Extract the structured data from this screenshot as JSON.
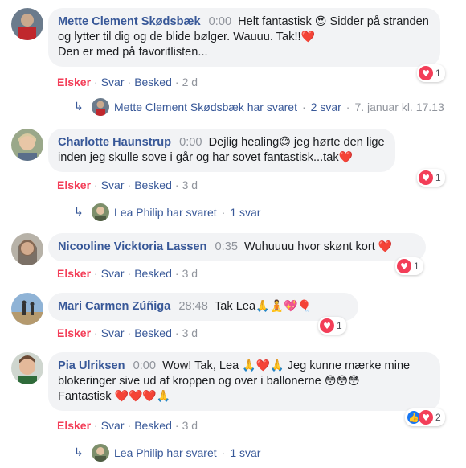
{
  "comments": [
    {
      "name": "Mette Clement Skødsbæk",
      "timestamp": "0:00",
      "text_a": "Helt fantastisk ",
      "emoji_a": "😍",
      "text_b": " Sidder på stranden og lytter til dig og de blide bølger. Wauuu. Tak!!",
      "emoji_b": "❤️",
      "text_c": "Den er med på favoritlisten...",
      "reaction_count": "1",
      "reaction_icon": "heart-icon",
      "actions": {
        "react": "Elsker",
        "reply": "Svar",
        "message": "Besked",
        "age": "2 d"
      },
      "reply_summary": {
        "author": "Mette Clement Skødsbæk har svaret",
        "count": "2 svar",
        "date": "7. januar kl. 17.13"
      }
    },
    {
      "name": "Charlotte Haunstrup",
      "timestamp": "0:00",
      "text_a": "Dejlig healing",
      "emoji_a": "😊",
      "text_b": " jeg hørte den lige inden jeg skulle sove i går og har sovet fantastisk...tak",
      "emoji_b": "❤️",
      "reaction_count": "1",
      "reaction_icon": "heart-icon",
      "actions": {
        "react": "Elsker",
        "reply": "Svar",
        "message": "Besked",
        "age": "3 d"
      },
      "reply_summary": {
        "author": "Lea Philip har svaret",
        "count": "1 svar"
      }
    },
    {
      "name": "Nicooline Vicktoria Lassen",
      "timestamp": "0:35",
      "text_a": "Wuhuuuu hvor skønt kort ",
      "emoji_a": "❤️",
      "reaction_count": "1",
      "reaction_icon": "heart-icon",
      "actions": {
        "react": "Elsker",
        "reply": "Svar",
        "message": "Besked",
        "age": "3 d"
      }
    },
    {
      "name": "Mari Carmen Zúñiga",
      "timestamp": "28:48",
      "text_a": "Tak Lea",
      "emoji_a": "🙏🧘💖🎈",
      "reaction_count": "1",
      "reaction_icon": "heart-icon",
      "actions": {
        "react": "Elsker",
        "reply": "Svar",
        "message": "Besked",
        "age": "3 d"
      }
    },
    {
      "name": "Pia Ulriksen",
      "timestamp": "0:00",
      "text_a": "Wow! Tak, Lea ",
      "emoji_a": "🙏❤️🙏",
      "text_b": " Jeg kunne mærke mine blokeringer sive ud af kroppen og over i ballonerne ",
      "emoji_b": "😳😳😳",
      "text_c": "Fantastisk ",
      "emoji_c": "❤️❤️❤️🙏",
      "reaction_count": "2",
      "reaction_icon": "like-and-heart-icon",
      "actions": {
        "react": "Elsker",
        "reply": "Svar",
        "message": "Besked",
        "age": "3 d"
      },
      "reply_summary": {
        "author": "Lea Philip har svaret",
        "count": "1 svar"
      }
    }
  ],
  "colors": {
    "name": "#385898",
    "love": "#f33e58",
    "like": "#1877f2",
    "bubble": "#f2f3f5",
    "meta": "#90949c"
  },
  "glyphs": {
    "separator": "·",
    "reply_arrow": "↳",
    "heart": "♥",
    "thumb": "👍"
  }
}
